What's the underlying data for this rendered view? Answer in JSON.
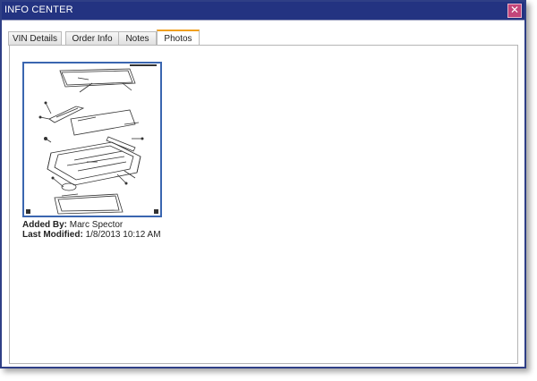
{
  "window": {
    "title": "INFO CENTER",
    "close_glyph": "✕"
  },
  "tabs": [
    {
      "label": "VIN Details",
      "active": false
    },
    {
      "label": "Order Info",
      "active": false
    },
    {
      "label": "Notes",
      "active": false
    },
    {
      "label": "Photos",
      "active": true
    }
  ],
  "photo": {
    "icon": "sunroof-assembly-diagram",
    "added_by_label": "Added By:",
    "added_by": "Marc Spector",
    "last_modified_label": "Last Modified:",
    "last_modified": "1/8/2013 10:12 AM"
  },
  "colors": {
    "titlebar": "#233381",
    "active_tab_accent": "#f0a020",
    "photo_border": "#3a66b0",
    "close_button": "#c3457a"
  }
}
